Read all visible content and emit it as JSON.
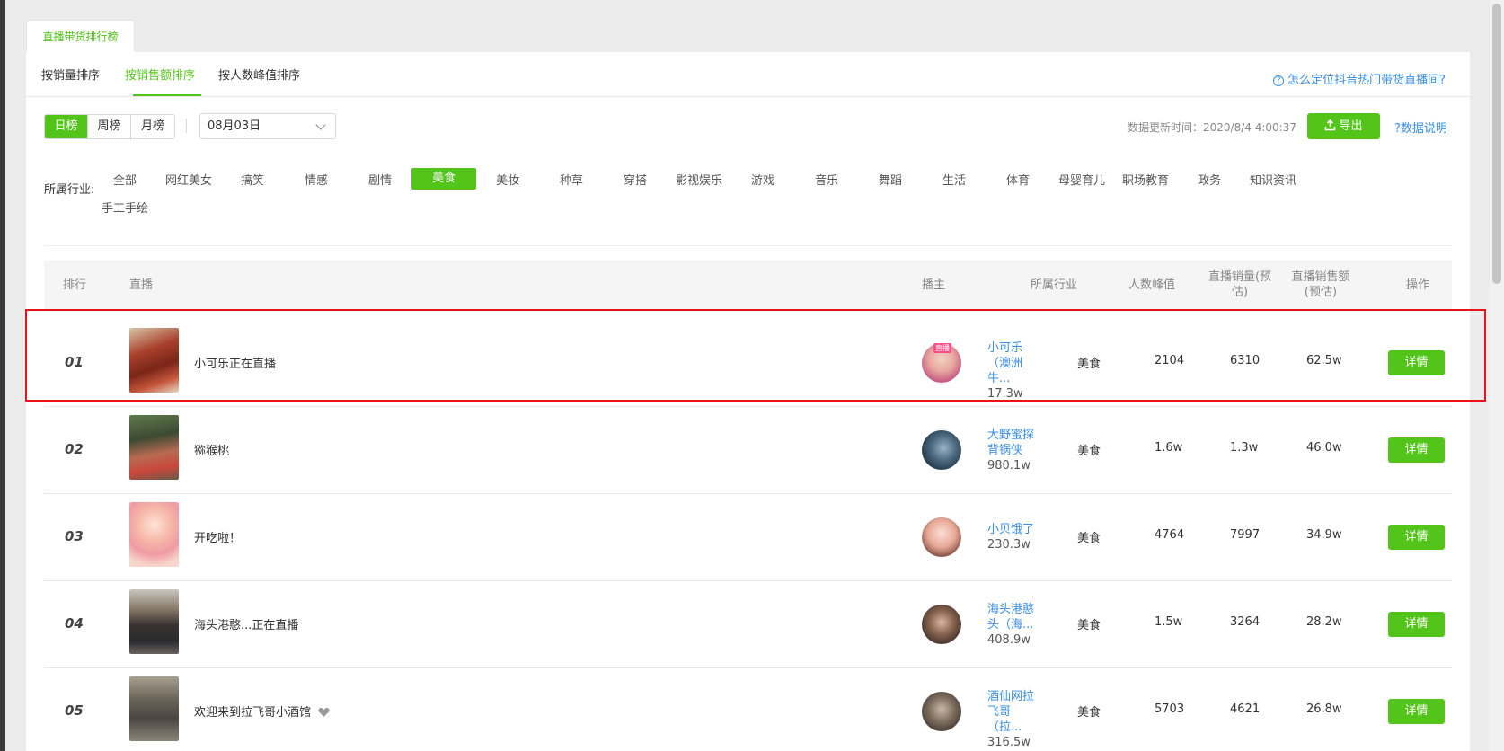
{
  "outer_tab": {
    "label": "直播带货排行榜"
  },
  "subtabs": [
    {
      "label": "按销量排序"
    },
    {
      "label": "按销售额排序",
      "active": true
    },
    {
      "label": "按人数峰值排序"
    }
  ],
  "help_link": {
    "label": "怎么定位抖音热门带货直播间?",
    "icon": "question-circle-icon"
  },
  "period_tabs": [
    {
      "label": "日榜",
      "active": true
    },
    {
      "label": "周榜"
    },
    {
      "label": "月榜"
    }
  ],
  "date_select": {
    "value": "08月03日"
  },
  "update_time": "数据更新时间：2020/8/4 4:00:37",
  "export_button": {
    "label": "导出",
    "icon": "upload-icon"
  },
  "data_explain": {
    "label": "数据说明",
    "icon": "question-circle-icon"
  },
  "industry": {
    "label": "所属行业:",
    "items": [
      "全部",
      "网红美女",
      "搞笑",
      "情感",
      "剧情",
      "美食",
      "美妆",
      "种草",
      "穿搭",
      "影视娱乐",
      "游戏",
      "音乐",
      "舞蹈",
      "生活",
      "体育",
      "母婴育儿",
      "职场教育",
      "政务",
      "知识资讯",
      "手工手绘"
    ],
    "active": "美食"
  },
  "table": {
    "headers": {
      "rank": "排行",
      "live": "直播",
      "anchor": "播主",
      "industry": "所属行业",
      "peak": "人数峰值",
      "sales_volume_1": "直播销量(预",
      "sales_volume_2": "估)",
      "sales_amount_1": "直播销售额",
      "sales_amount_2": "(预估)",
      "action": "操作"
    },
    "rows": [
      {
        "rank": "01",
        "title": "小可乐正在直播",
        "anchor_line1": "小可乐",
        "anchor_line2": "（澳洲牛...",
        "fans": "17.3w",
        "live_tag": "直播",
        "industry": "美食",
        "peak": "2104",
        "volume": "6310",
        "amount": "62.5w",
        "action": "详情"
      },
      {
        "rank": "02",
        "title": "猕猴桃",
        "anchor_line1": "大野蜜探",
        "anchor_line2": "背锅侠",
        "fans": "980.1w",
        "industry": "美食",
        "peak": "1.6w",
        "volume": "1.3w",
        "amount": "46.0w",
        "action": "详情"
      },
      {
        "rank": "03",
        "title": "开吃啦！",
        "anchor_line1": "小贝饿了",
        "anchor_line2": "",
        "fans": "230.3w",
        "industry": "美食",
        "peak": "4764",
        "volume": "7997",
        "amount": "34.9w",
        "action": "详情"
      },
      {
        "rank": "04",
        "title": "海头港憨...正在直播",
        "anchor_line1": "海头港憨",
        "anchor_line2": "头（海...",
        "fans": "408.9w",
        "industry": "美食",
        "peak": "1.5w",
        "volume": "3264",
        "amount": "28.2w",
        "action": "详情"
      },
      {
        "rank": "05",
        "title": "欢迎来到拉飞哥小酒馆",
        "anchor_line1": "酒仙网拉",
        "anchor_line2": "飞哥（拉...",
        "fans": "316.5w",
        "industry": "美食",
        "peak": "5703",
        "volume": "4621",
        "amount": "26.8w",
        "action": "详情",
        "heart_icon": "heart-icon"
      }
    ]
  },
  "colors": {
    "accent": "#52c41a",
    "link": "#3a8ee6",
    "highlight": "#e8141c"
  }
}
